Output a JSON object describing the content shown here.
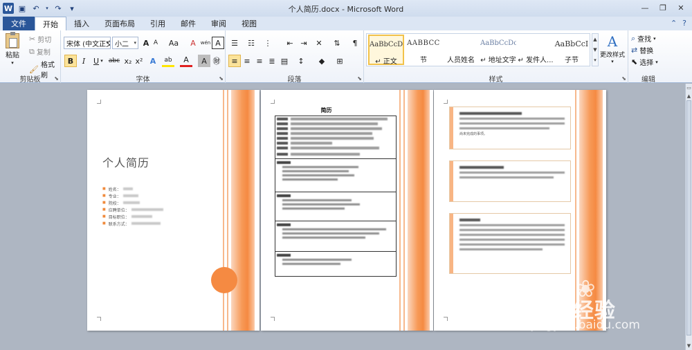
{
  "window": {
    "title": "个人简历.docx - Microsoft Word",
    "app_icon": "word-icon",
    "controls": [
      "minimize-icon",
      "restore-icon",
      "close-icon"
    ]
  },
  "quick_access": {
    "save": "save-icon",
    "undo": "undo-icon",
    "redo": "redo-icon",
    "customize": "▾"
  },
  "tabs": [
    {
      "label": "文件"
    },
    {
      "label": "开始"
    },
    {
      "label": "插入"
    },
    {
      "label": "页面布局"
    },
    {
      "label": "引用"
    },
    {
      "label": "邮件"
    },
    {
      "label": "审阅"
    },
    {
      "label": "视图"
    }
  ],
  "active_tab": "开始",
  "ribbon": {
    "clipboard": {
      "label": "剪贴板",
      "paste": "粘贴",
      "cut": "剪切",
      "copy": "复制",
      "format_painter": "格式刷"
    },
    "font": {
      "label": "字体",
      "font_name": "宋体 (中文正文)",
      "font_size": "小二",
      "bold": "B",
      "italic": "I",
      "underline": "U",
      "strikethrough": "abc",
      "subscript": "x₂",
      "superscript": "x²",
      "grow": "A",
      "shrink": "A",
      "change_case": "Aa",
      "clear_format": "A",
      "text_effects": "A",
      "highlight": "ab",
      "font_color": "A",
      "char_shading": "A",
      "enclose": "㊖",
      "phonetic": "wén",
      "border": "A"
    },
    "paragraph": {
      "label": "段落"
    },
    "styles": {
      "label": "样式",
      "items": [
        {
          "sample": "AaBbCcDc",
          "name": "↵ 正文",
          "selected": true
        },
        {
          "sample": "AABBCC",
          "name": "节",
          "selected": false
        },
        {
          "sample": "",
          "name": "人员姓名",
          "selected": false
        },
        {
          "sample": "AaBbCcDc",
          "name": "↵ 地址文字",
          "selected": false
        },
        {
          "sample": "",
          "name": "↵ 发件人...",
          "selected": false
        },
        {
          "sample": "AaBbCcI",
          "name": "子节",
          "selected": false
        }
      ],
      "change_styles": "更改样式"
    },
    "editing": {
      "label": "编辑",
      "find": "查找",
      "replace": "替换",
      "select": "选择"
    }
  },
  "document": {
    "page1": {
      "title": "个人简历",
      "fields": [
        "姓名：",
        "专业：",
        "院校：",
        "应聘单位：",
        "目标职位：",
        "联系方式："
      ]
    },
    "page2": {
      "title": "简历"
    },
    "page3": {
      "fragment": "尚未完成的事项。"
    }
  },
  "watermark": {
    "brand": "Bai 经验",
    "url": "jingyan.baidu.com"
  },
  "colors": {
    "accent_orange": "#f58a42",
    "file_tab": "#2a5699",
    "selected_style": "#f2c24a"
  }
}
